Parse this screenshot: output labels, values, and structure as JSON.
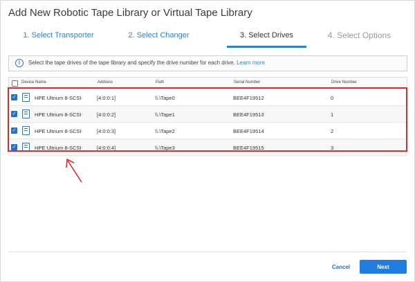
{
  "dialog": {
    "title": "Add New Robotic Tape Library or Virtual Tape Library"
  },
  "wizard": {
    "steps": [
      {
        "label": "1. Select Transporter",
        "state": "done"
      },
      {
        "label": "2. Select Changer",
        "state": "done"
      },
      {
        "label": "3. Select Drives",
        "state": "active"
      },
      {
        "label": "4. Select Options",
        "state": "future"
      }
    ]
  },
  "info": {
    "icon": "info-icon",
    "text": "Select the tape drives of the tape library and specify the drive number for each drive.",
    "link": "Learn more"
  },
  "table": {
    "headers": {
      "device_name": "Device Name",
      "address": "Address",
      "path": "Path",
      "serial_number": "Serial Number",
      "drive_number": "Drive Number"
    },
    "rows": [
      {
        "checked": true,
        "device_name": "HPE Ultrium 8-SCSI",
        "address": "[4:0:0:1]",
        "path": "\\\\.\\Tape0",
        "serial_number": "BEE4F19512",
        "drive_number": "0"
      },
      {
        "checked": true,
        "device_name": "HPE Ultrium 8-SCSI",
        "address": "[4:0:0:2]",
        "path": "\\\\.\\Tape1",
        "serial_number": "BEE4F19513",
        "drive_number": "1"
      },
      {
        "checked": true,
        "device_name": "HPE Ultrium 8-SCSI",
        "address": "[4:0:0:3]",
        "path": "\\\\.\\Tape2",
        "serial_number": "BEE4F19514",
        "drive_number": "2"
      },
      {
        "checked": true,
        "device_name": "HPE Ultrium 8-SCSI",
        "address": "[4:0:0:4]",
        "path": "\\\\.\\Tape3",
        "serial_number": "BEE4F19515",
        "drive_number": "3"
      }
    ]
  },
  "footer": {
    "cancel_label": "Cancel",
    "next_label": "Next"
  },
  "colors": {
    "accent": "#2e83c6",
    "primary_button": "#1f7ddf",
    "highlight_box": "#d32f2f"
  }
}
